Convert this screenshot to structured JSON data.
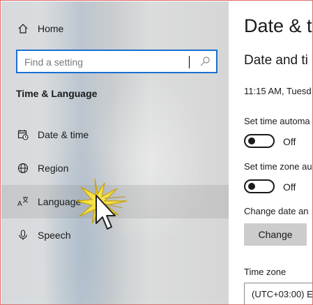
{
  "sidebar": {
    "home_label": "Home",
    "search_placeholder": "Find a setting",
    "section_title": "Time & Language",
    "items": [
      {
        "label": "Date & time",
        "icon": "calendar-clock-icon"
      },
      {
        "label": "Region",
        "icon": "globe-icon"
      },
      {
        "label": "Language",
        "icon": "language-icon"
      },
      {
        "label": "Speech",
        "icon": "microphone-icon"
      }
    ],
    "highlighted_item": "Language"
  },
  "content": {
    "page_title": "Date & t",
    "subtitle": "Date and ti",
    "current_time": "11:15 AM, Tuesd",
    "set_time_auto_label": "Set time automa",
    "set_time_auto_state": "Off",
    "set_timezone_auto_label": "Set time zone au",
    "set_timezone_auto_state": "Off",
    "change_date_label": "Change date an",
    "change_button": "Change",
    "timezone_label": "Time zone",
    "timezone_value": "(UTC+03:00) E"
  },
  "colors": {
    "accent": "#1a6fd0",
    "border": "#e06a6a",
    "button_bg": "#cccccc",
    "highlight": "#c8c8c8"
  }
}
